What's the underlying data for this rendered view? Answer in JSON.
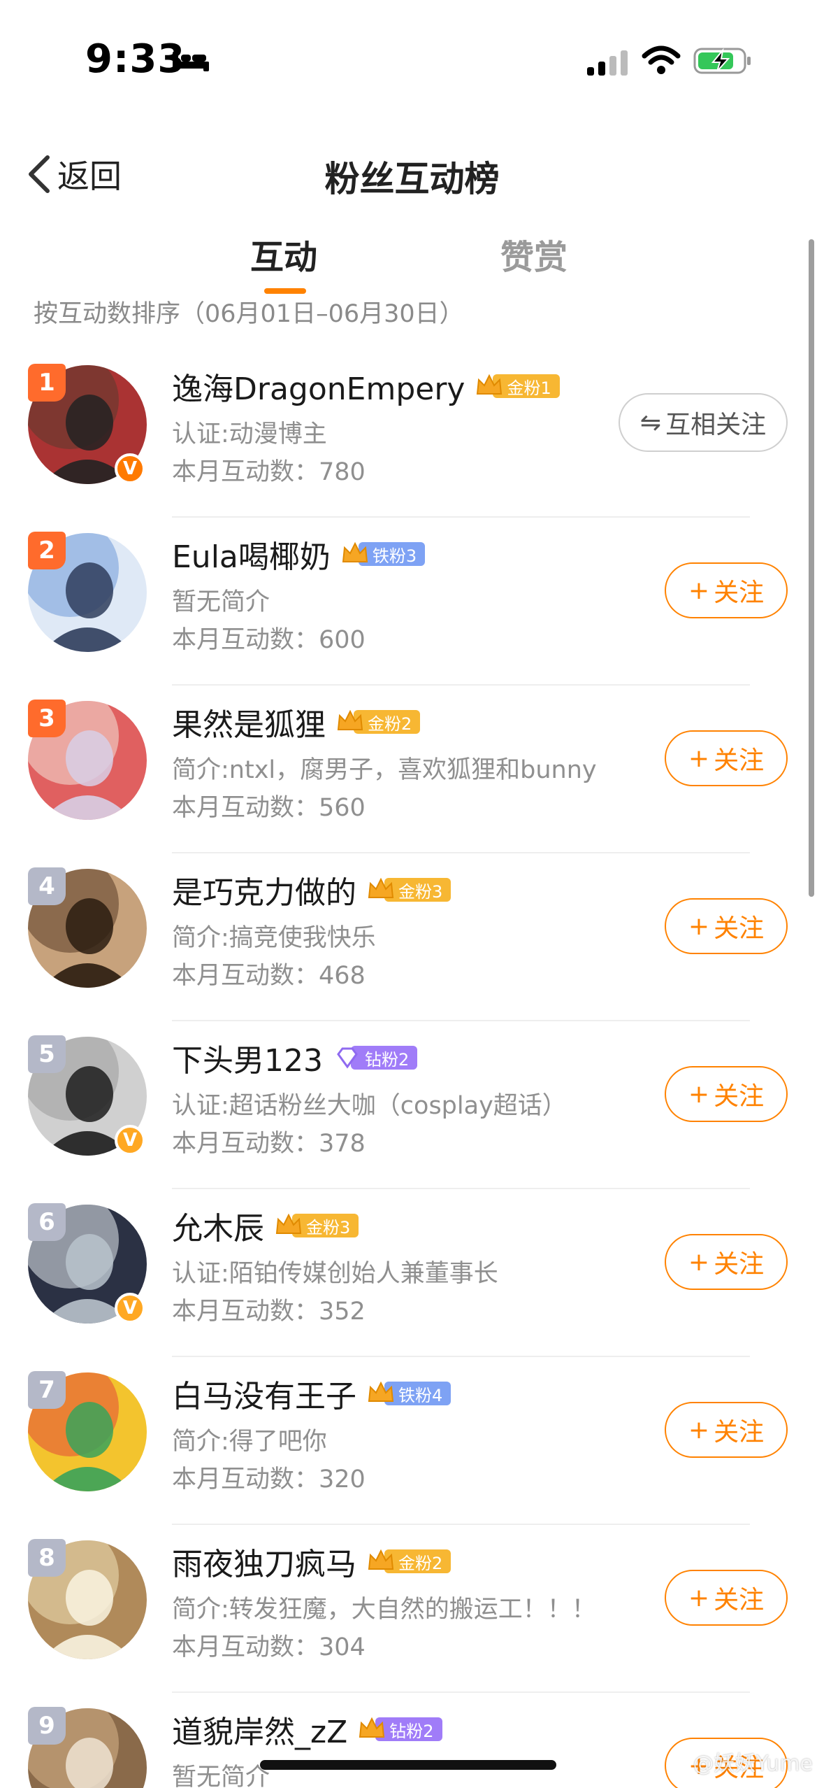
{
  "status_bar": {
    "time": "9:33"
  },
  "nav": {
    "back_label": "返回",
    "title": "粉丝互动榜"
  },
  "tabs": [
    {
      "label": "互动",
      "active": true
    },
    {
      "label": "赞赏",
      "active": false
    }
  ],
  "sort_note": "按互动数排序（06月01日–06月30日）",
  "fans": [
    {
      "rank": "1",
      "name": "逸海DragonEmpery",
      "badge": {
        "crown": "",
        "label": "金粉1",
        "tier": "gold"
      },
      "bio": "认证:动漫博主",
      "count": "本月互动数：780",
      "verified": "red",
      "button": {
        "type": "mutual",
        "label": "互相关注",
        "icon": "⇋"
      },
      "avatar_colors": [
        "#5a3a2e",
        "#a33",
        "#222"
      ]
    },
    {
      "rank": "2",
      "name": "Eula喝椰奶",
      "badge": {
        "crown": "2",
        "label": "铁粉3",
        "tier": "iron"
      },
      "bio": "暂无简介",
      "count": "本月互动数：600",
      "verified": "",
      "button": {
        "type": "follow",
        "label": "关注",
        "icon": "+"
      },
      "avatar_colors": [
        "#6f9ad8",
        "#dfe9f6",
        "#2f3d5c"
      ]
    },
    {
      "rank": "3",
      "name": "果然是狐狸",
      "badge": {
        "crown": "6",
        "label": "金粉2",
        "tier": "gold"
      },
      "bio": "简介:ntxl，腐男子，喜欢狐狸和bunny",
      "count": "本月互动数：560",
      "verified": "",
      "button": {
        "type": "follow",
        "label": "关注",
        "icon": "+"
      },
      "avatar_colors": [
        "#f4e3d8",
        "#e06060",
        "#d8cfe6"
      ]
    },
    {
      "rank": "4",
      "name": "是巧克力做的",
      "badge": {
        "crown": "3",
        "label": "金粉3",
        "tier": "gold"
      },
      "bio": "简介:搞竞使我快乐",
      "count": "本月互动数：468",
      "verified": "",
      "button": {
        "type": "follow",
        "label": "关注",
        "icon": "+"
      },
      "avatar_colors": [
        "#5a3d26",
        "#c7a27c",
        "#2a1c10"
      ]
    },
    {
      "rank": "5",
      "name": "下头男123",
      "badge": {
        "crown": "",
        "label": "钻粉2",
        "tier": "diamond"
      },
      "bio": "认证:超话粉丝大咖（cosplay超话）",
      "count": "本月互动数：378",
      "verified": "gold",
      "button": {
        "type": "follow",
        "label": "关注",
        "icon": "+"
      },
      "avatar_colors": [
        "#9a9a9a",
        "#d0d0d0",
        "#1c1c1c"
      ]
    },
    {
      "rank": "6",
      "name": "允木辰",
      "badge": {
        "crown": "7",
        "label": "金粉3",
        "tier": "gold"
      },
      "bio": "认证:陌铂传媒创始人兼董事长",
      "count": "本月互动数：352",
      "verified": "gold",
      "button": {
        "type": "follow",
        "label": "关注",
        "icon": "+"
      },
      "avatar_colors": [
        "#e7edf2",
        "#2b3144",
        "#b9c3cc"
      ]
    },
    {
      "rank": "7",
      "name": "白马没有王子",
      "badge": {
        "crown": "2",
        "label": "铁粉4",
        "tier": "iron"
      },
      "bio": "简介:得了吧你",
      "count": "本月互动数：320",
      "verified": "",
      "button": {
        "type": "follow",
        "label": "关注",
        "icon": "+"
      },
      "avatar_colors": [
        "#e14b3a",
        "#f3c42e",
        "#3aa35a"
      ]
    },
    {
      "rank": "8",
      "name": "雨夜独刀疯马",
      "badge": {
        "crown": "5",
        "label": "金粉2",
        "tier": "gold"
      },
      "bio": "简介:转发狂魔，大自然的搬运工！！！",
      "count": "本月互动数：304",
      "verified": "",
      "button": {
        "type": "follow",
        "label": "关注",
        "icon": "+"
      },
      "avatar_colors": [
        "#f1e1b8",
        "#b08a5a",
        "#f9f3e0"
      ]
    },
    {
      "rank": "9",
      "name": "道貌岸然_zZ",
      "badge": {
        "crown": "4",
        "label": "钻粉2",
        "tier": "diamond"
      },
      "bio": "暂无简介",
      "count": "",
      "verified": "",
      "button": {
        "type": "follow",
        "label": "关注",
        "icon": "+"
      },
      "avatar_colors": [
        "#d9b48a",
        "#8a6a4a",
        "#efe3d2"
      ]
    }
  ],
  "watermark": "@妖妖Yume",
  "colors": {
    "accent": "#ff8200",
    "rank_top": "#ff6b2c",
    "rank_normal": "#b4b8c8",
    "gold": "#f7b733",
    "iron": "#7ea2f4",
    "diamond": "#a07cf8"
  }
}
